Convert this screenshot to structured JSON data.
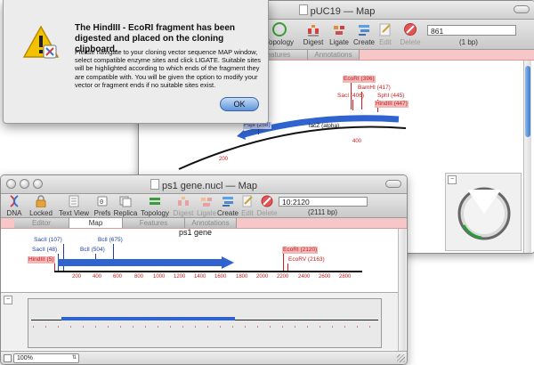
{
  "back_window": {
    "title": "pUC19 — Map",
    "toolbar": {
      "topology": "Topology",
      "digest": "Digest",
      "ligate": "Ligate",
      "create": "Create",
      "edit": "Edit",
      "delete": "Delete",
      "position_value": "861",
      "length": "(1 bp)"
    },
    "tabs": {
      "features": "Features",
      "annotations": "Annotations"
    },
    "map": {
      "labels": [
        {
          "text": "EcoRI (396)",
          "color": "red",
          "hl": true
        },
        {
          "text": "BamHI (417)",
          "color": "red",
          "hl": false
        },
        {
          "text": "SacI (406)",
          "color": "red",
          "hl": false
        },
        {
          "text": "SphI (445)",
          "color": "red",
          "hl": false
        },
        {
          "text": "HindIII (447)",
          "color": "red",
          "hl": true
        },
        {
          "text": "FspI (258)",
          "color": "blue",
          "hl": true
        }
      ],
      "feature_label": "lacZ (alpha)",
      "tick_200": "200",
      "tick_400": "400"
    }
  },
  "alert": {
    "title": "The HindIII - EcoRI fragment has been digested and placed on the cloning clipboard.",
    "body": "Please navigate to your cloning vector sequence MAP window, select compatible enzyme sites and click LIGATE. Suitable sites will be highlighted according to which ends of the fragment they are compatible with. You will be given the option to modify your vector or fragment ends if no suitable sites exist.",
    "ok": "OK"
  },
  "front_window": {
    "title": "ps1 gene.nucl — Map",
    "toolbar": {
      "dna": "DNA",
      "locked": "Locked",
      "text_view": "Text View",
      "prefs": "Prefs",
      "replica": "Replica",
      "topology": "Topology",
      "digest": "Digest",
      "ligate": "Ligate",
      "create": "Create",
      "edit": "Edit",
      "delete": "Delete",
      "range_value": "10:2120",
      "length": "(2111 bp)"
    },
    "tabs": {
      "editor": "Editor",
      "map": "Map",
      "features": "Features",
      "annotations": "Annotations"
    },
    "map": {
      "gene_name": "ps1 gene",
      "labels": [
        {
          "text": "SacII (107)",
          "color": "blue",
          "hl": false
        },
        {
          "text": "SacII (48)",
          "color": "blue",
          "hl": false
        },
        {
          "text": "HindIII (5)",
          "color": "red",
          "hl": true
        },
        {
          "text": "BclI (675)",
          "color": "blue",
          "hl": false
        },
        {
          "text": "BclI (504)",
          "color": "blue",
          "hl": false
        },
        {
          "text": "EcoRI (2120)",
          "color": "red",
          "hl": true
        },
        {
          "text": "EcoRV (2163)",
          "color": "red",
          "hl": false
        }
      ],
      "ruler": [
        "200",
        "400",
        "600",
        "800",
        "1000",
        "1200",
        "1400",
        "1600",
        "1800",
        "2000",
        "2200",
        "2400",
        "2600",
        "2800"
      ]
    },
    "zoom": "100%"
  },
  "colors": {
    "feature_blue": "#2f63cf",
    "enzyme_red": "#c81e1e",
    "enzyme_blue": "#1c3fa8",
    "tab_pink": "#f7c7c7"
  }
}
